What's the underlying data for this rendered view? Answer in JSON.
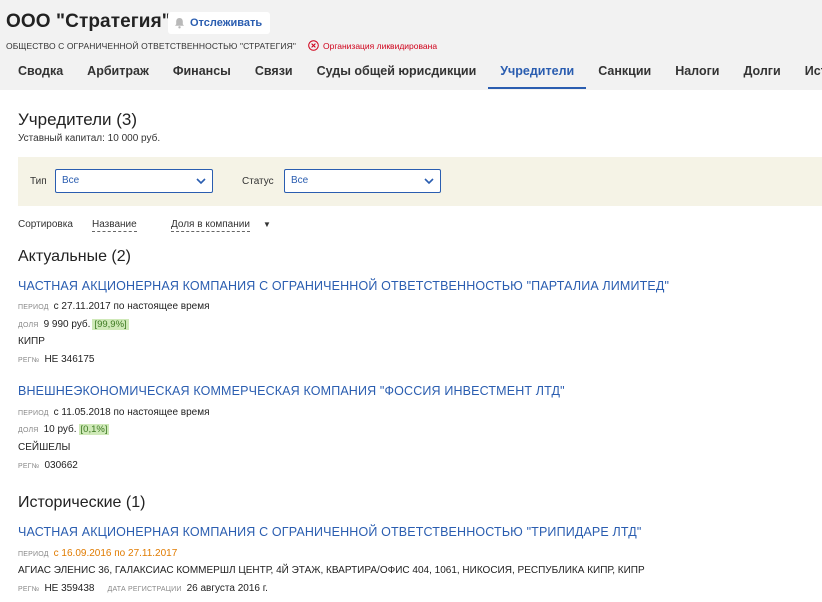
{
  "header": {
    "title": "ООО \"Стратегия\"",
    "track_label": "Отслеживать",
    "full_name": "ОБЩЕСТВО С ОГРАНИЧЕННОЙ ОТВЕТСТВЕННОСТЬЮ \"СТРАТЕГИЯ\"",
    "status": "Организация ликвидирована",
    "status_color": "#d0021b"
  },
  "tabs": [
    {
      "label": "Сводка"
    },
    {
      "label": "Арбитраж"
    },
    {
      "label": "Финансы"
    },
    {
      "label": "Связи"
    },
    {
      "label": "Суды общей юрисдикции"
    },
    {
      "label": "Учредители",
      "active": true
    },
    {
      "label": "Санкции"
    },
    {
      "label": "Налоги"
    },
    {
      "label": "Долги"
    },
    {
      "label": "Истор"
    }
  ],
  "founders": {
    "title": "Учредители (3)",
    "capital": "Уставный капитал: 10 000 руб.",
    "filters": {
      "type_label": "Тип",
      "type_value": "Все",
      "status_label": "Статус",
      "status_value": "Все"
    },
    "sort": {
      "label": "Сортировка",
      "by_name": "Название",
      "by_share": "Доля в компании"
    },
    "current_title": "Актуальные (2)",
    "historical_title": "Исторические (1)",
    "labels": {
      "period": "период",
      "share": "доля",
      "reg_no": "рег№",
      "reg_date": "дата регистрации"
    },
    "current": [
      {
        "name": "ЧАСТНАЯ АКЦИОНЕРНАЯ КОМПАНИЯ С ОГРАНИЧЕННОЙ ОТВЕТСТВЕННОСТЬЮ \"ПАРТАЛИА ЛИМИТЕД\"",
        "period": "с 27.11.2017 по настоящее время",
        "share": "9 990 руб.",
        "share_pct": "[99,9%]",
        "country": "КИПР",
        "reg_no": "HE 346175"
      },
      {
        "name": "ВНЕШНЕЭКОНОМИЧЕСКАЯ КОММЕРЧЕСКАЯ КОМПАНИЯ \"ФОССИЯ ИНВЕСТМЕНТ ЛТД\"",
        "period": "с 11.05.2018 по настоящее время",
        "share": "10 руб.",
        "share_pct": "[0,1%]",
        "country": "СЕЙШЕЛЫ",
        "reg_no": "030662"
      }
    ],
    "historical": [
      {
        "name": "ЧАСТНАЯ АКЦИОНЕРНАЯ КОМПАНИЯ С ОГРАНИЧЕННОЙ ОТВЕТСТВЕННОСТЬЮ \"ТРИПИДАРЕ ЛТД\"",
        "period": "с 16.09.2016 по 27.11.2017",
        "address": "АГИАС ЭЛЕНИС 36, ГАЛАКСИАС КОММЕРШЛ ЦЕНТР, 4Й ЭТАЖ, КВАРТИРА/ОФИС 404, 1061, НИКОСИЯ, РЕСПУБЛИКА КИПР, КИПР",
        "reg_no": "HE 359438",
        "reg_date": "26 августа 2016 г."
      }
    ]
  },
  "colors": {
    "accent": "#2a5db0",
    "historical_period": "#e07b00",
    "share_badge_bg": "#cfe9b8",
    "filter_bg": "#f5f3e6"
  }
}
